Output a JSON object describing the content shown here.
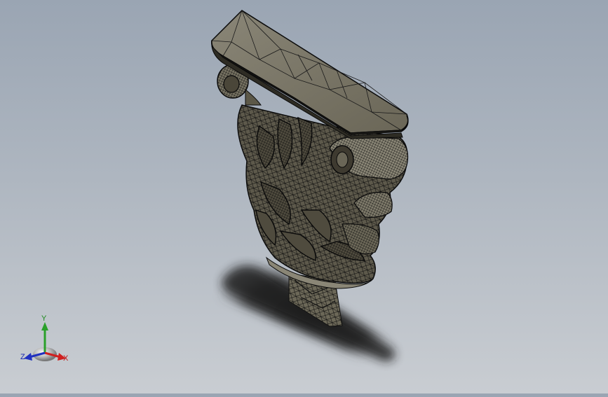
{
  "viewport": {
    "background_top": "#9aa5b3",
    "background_bottom": "#c9cdd2",
    "model": {
      "name": "corbel",
      "render_mode": "shaded-with-edges",
      "surface_color": "#6f6a5c",
      "edge_color": "#111111"
    }
  },
  "triad": {
    "x_label": "X",
    "y_label": "Y",
    "z_label": "Z",
    "x_color": "#d02020",
    "y_color": "#2aa02a",
    "z_color": "#2030c0"
  }
}
